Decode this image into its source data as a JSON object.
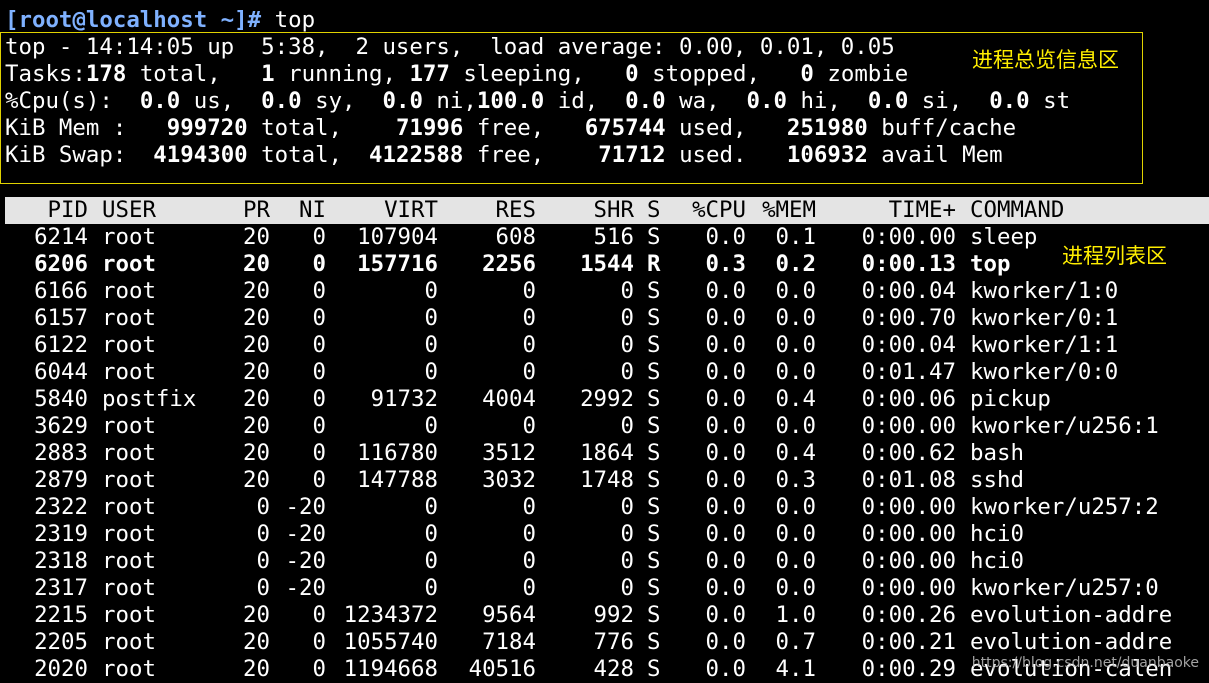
{
  "terminal": {
    "prompt": "[root@localhost ~]#",
    "command": " top",
    "summary": {
      "line1": "top - 14:14:05 up  5:38,  2 users,  load average: 0.00, 0.01, 0.05",
      "tasks_label": "Tasks:",
      "tasks_total": "178",
      "tasks_total_lbl": " total,   ",
      "tasks_running": "1",
      "tasks_running_lbl": " running, ",
      "tasks_sleeping": "177",
      "tasks_sleeping_lbl": " sleeping,   ",
      "tasks_stopped": "0",
      "tasks_stopped_lbl": " stopped,   ",
      "tasks_zombie": "0",
      "tasks_zombie_lbl": " zombie",
      "cpu_label": "%Cpu(s):  ",
      "cpu_us": "0.0",
      "cpu_us_lbl": " us,  ",
      "cpu_sy": "0.0",
      "cpu_sy_lbl": " sy,  ",
      "cpu_ni": "0.0",
      "cpu_ni_lbl": " ni,",
      "cpu_id": "100.0",
      "cpu_id_lbl": " id,  ",
      "cpu_wa": "0.0",
      "cpu_wa_lbl": " wa,  ",
      "cpu_hi": "0.0",
      "cpu_hi_lbl": " hi,  ",
      "cpu_si": "0.0",
      "cpu_si_lbl": " si,  ",
      "cpu_st": "0.0",
      "cpu_st_lbl": " st",
      "mem_label": "KiB Mem :   ",
      "mem_total": "999720",
      "mem_total_lbl": " total,    ",
      "mem_free": "71996",
      "mem_free_lbl": " free,   ",
      "mem_used": "675744",
      "mem_used_lbl": " used,   ",
      "mem_cache": "251980",
      "mem_cache_lbl": " buff/cache",
      "swap_label": "KiB Swap:  ",
      "swap_total": "4194300",
      "swap_total_lbl": " total,  ",
      "swap_free": "4122588",
      "swap_free_lbl": " free,    ",
      "swap_used": "71712",
      "swap_used_lbl": " used.   ",
      "swap_avail": "106932",
      "swap_avail_lbl": " avail Mem"
    },
    "annotation_summary": "进程总览信息区",
    "annotation_list": "进程列表区",
    "columns": [
      "PID",
      "USER",
      "PR",
      "NI",
      "VIRT",
      "RES",
      "SHR",
      "S",
      "%CPU",
      "%MEM",
      "TIME+",
      "COMMAND"
    ],
    "processes": [
      [
        "6214",
        "root",
        "20",
        "0",
        "107904",
        "608",
        "516",
        "S",
        "0.0",
        "0.1",
        "0:00.00",
        "sleep"
      ],
      [
        "6206",
        "root",
        "20",
        "0",
        "157716",
        "2256",
        "1544",
        "R",
        "0.3",
        "0.2",
        "0:00.13",
        "top"
      ],
      [
        "6166",
        "root",
        "20",
        "0",
        "0",
        "0",
        "0",
        "S",
        "0.0",
        "0.0",
        "0:00.04",
        "kworker/1:0"
      ],
      [
        "6157",
        "root",
        "20",
        "0",
        "0",
        "0",
        "0",
        "S",
        "0.0",
        "0.0",
        "0:00.70",
        "kworker/0:1"
      ],
      [
        "6122",
        "root",
        "20",
        "0",
        "0",
        "0",
        "0",
        "S",
        "0.0",
        "0.0",
        "0:00.04",
        "kworker/1:1"
      ],
      [
        "6044",
        "root",
        "20",
        "0",
        "0",
        "0",
        "0",
        "S",
        "0.0",
        "0.0",
        "0:01.47",
        "kworker/0:0"
      ],
      [
        "5840",
        "postfix",
        "20",
        "0",
        "91732",
        "4004",
        "2992",
        "S",
        "0.0",
        "0.4",
        "0:00.06",
        "pickup"
      ],
      [
        "3629",
        "root",
        "20",
        "0",
        "0",
        "0",
        "0",
        "S",
        "0.0",
        "0.0",
        "0:00.00",
        "kworker/u256:1"
      ],
      [
        "2883",
        "root",
        "20",
        "0",
        "116780",
        "3512",
        "1864",
        "S",
        "0.0",
        "0.4",
        "0:00.62",
        "bash"
      ],
      [
        "2879",
        "root",
        "20",
        "0",
        "147788",
        "3032",
        "1748",
        "S",
        "0.0",
        "0.3",
        "0:01.08",
        "sshd"
      ],
      [
        "2322",
        "root",
        "0",
        "-20",
        "0",
        "0",
        "0",
        "S",
        "0.0",
        "0.0",
        "0:00.00",
        "kworker/u257:2"
      ],
      [
        "2319",
        "root",
        "0",
        "-20",
        "0",
        "0",
        "0",
        "S",
        "0.0",
        "0.0",
        "0:00.00",
        "hci0"
      ],
      [
        "2318",
        "root",
        "0",
        "-20",
        "0",
        "0",
        "0",
        "S",
        "0.0",
        "0.0",
        "0:00.00",
        "hci0"
      ],
      [
        "2317",
        "root",
        "0",
        "-20",
        "0",
        "0",
        "0",
        "S",
        "0.0",
        "0.0",
        "0:00.00",
        "kworker/u257:0"
      ],
      [
        "2215",
        "root",
        "20",
        "0",
        "1234372",
        "9564",
        "992",
        "S",
        "0.0",
        "1.0",
        "0:00.26",
        "evolution-addre"
      ],
      [
        "2205",
        "root",
        "20",
        "0",
        "1055740",
        "7184",
        "776",
        "S",
        "0.0",
        "0.7",
        "0:00.21",
        "evolution-addre"
      ],
      [
        "2020",
        "root",
        "20",
        "0",
        "1194668",
        "40516",
        "428",
        "S",
        "0.0",
        "4.1",
        "0:00.29",
        "evolution-calen"
      ]
    ],
    "highlight_row_index": 1,
    "watermark": "https://blog.csdn.net/duanbaoke"
  }
}
